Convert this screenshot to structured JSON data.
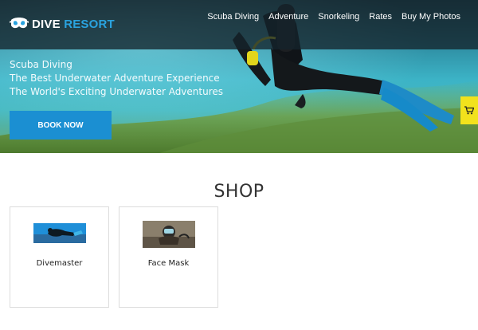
{
  "site": {
    "logo": {
      "prefix": "DIVE",
      "suffix": "RESORT"
    }
  },
  "nav": {
    "items": [
      {
        "label": "Scuba Diving"
      },
      {
        "label": "Adventure"
      },
      {
        "label": "Snorkeling"
      },
      {
        "label": "Rates"
      },
      {
        "label": "Buy My Photos"
      }
    ]
  },
  "hero": {
    "lines": [
      "Scuba Diving",
      "The Best Underwater Adventure Experience",
      "The World's Exciting Underwater Adventures"
    ],
    "cta_label": "BOOK NOW"
  },
  "cart": {
    "icon": "shopping-cart-icon"
  },
  "shop": {
    "title": "SHOP",
    "products": [
      {
        "name": "Divemaster"
      },
      {
        "name": "Face Mask"
      }
    ]
  },
  "colors": {
    "accent": "#2aa3df",
    "button": "#1b8fd2",
    "cart_tab": "#f2e21c",
    "topbar": "#14242c"
  }
}
